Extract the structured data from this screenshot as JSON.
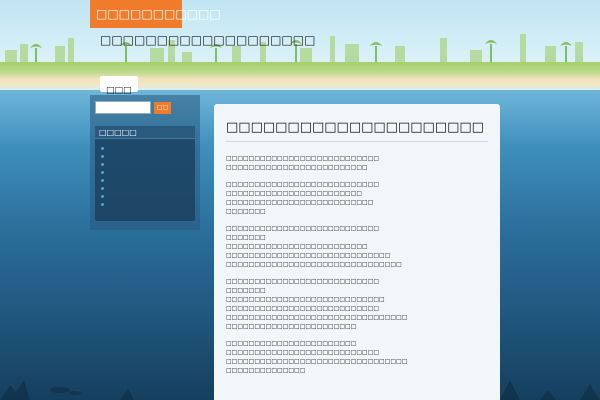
{
  "site": {
    "title": "□□□□□□□□□□□",
    "description": "□□□□□□□□□□□□□□□□□□□"
  },
  "nav": {
    "items": [
      {
        "label": "□□□"
      }
    ]
  },
  "sidebar": {
    "search": {
      "value": "",
      "placeholder": "",
      "button_label": "□□"
    },
    "widget": {
      "title": "□□□□□",
      "items": [
        {
          "label": ""
        },
        {
          "label": ""
        },
        {
          "label": ""
        },
        {
          "label": ""
        },
        {
          "label": ""
        },
        {
          "label": ""
        },
        {
          "label": ""
        },
        {
          "label": ""
        }
      ]
    }
  },
  "post": {
    "title": "□□□□□□□□□□□□□□□□□□□□□",
    "paragraphs": [
      [
        "□□□□□□□□□□□□□□□□□□□□□□□□□□□",
        "□□□□□□□□□□□□□□□□□□□□□□□□□"
      ],
      [
        "□□□□□□□□□□□□□□□□□□□□□□□□□□□",
        "□□□□□□□□□□□□□□□□□□□□□□□□",
        "□□□□□□□□□□□□□□□□□□□□□□□□□□",
        "□□□□□□□"
      ],
      [
        "□□□□□□□□□□□□□□□□□□□□□□□□□□□",
        "□□□□□□□",
        "□□□□□□□□□□□□□□□□□□□□□□□□□",
        "□□□□□□□□□□□□□□□□□□□□□□□□□□□□□",
        "□□□□□□□□□□□□□□□□□□□□□□□□□□□□□□□"
      ],
      [
        "□□□□□□□□□□□□□□□□□□□□□□□□□□□",
        "□□□□□□□",
        "□□□□□□□□□□□□□□□□□□□□□□□□□□□□",
        "□□□□□□□□□□□□□□□□□□□□□□□□□□□",
        "□□□□□□□□□□□□□□□□□□□□□□□□□□□□□□□□",
        "□□□□□□□□□□□□□□□□□□□□□□□"
      ],
      [
        "□□□□□□□□□□□□□□□□□□□□□□□",
        "□□□□□□□□□□□□□□□□□□□□□□□□□□□",
        "□□□□□□□□□□□□□□□□□□□□□□□□□□□□□□□□",
        "□□□□□□□□□□□□□□"
      ]
    ]
  },
  "colors": {
    "accent": "#f07b2b",
    "sea_top": "#6fb6d9",
    "sea_bottom": "#163f5e",
    "content_bg": "#f1f6f9"
  }
}
